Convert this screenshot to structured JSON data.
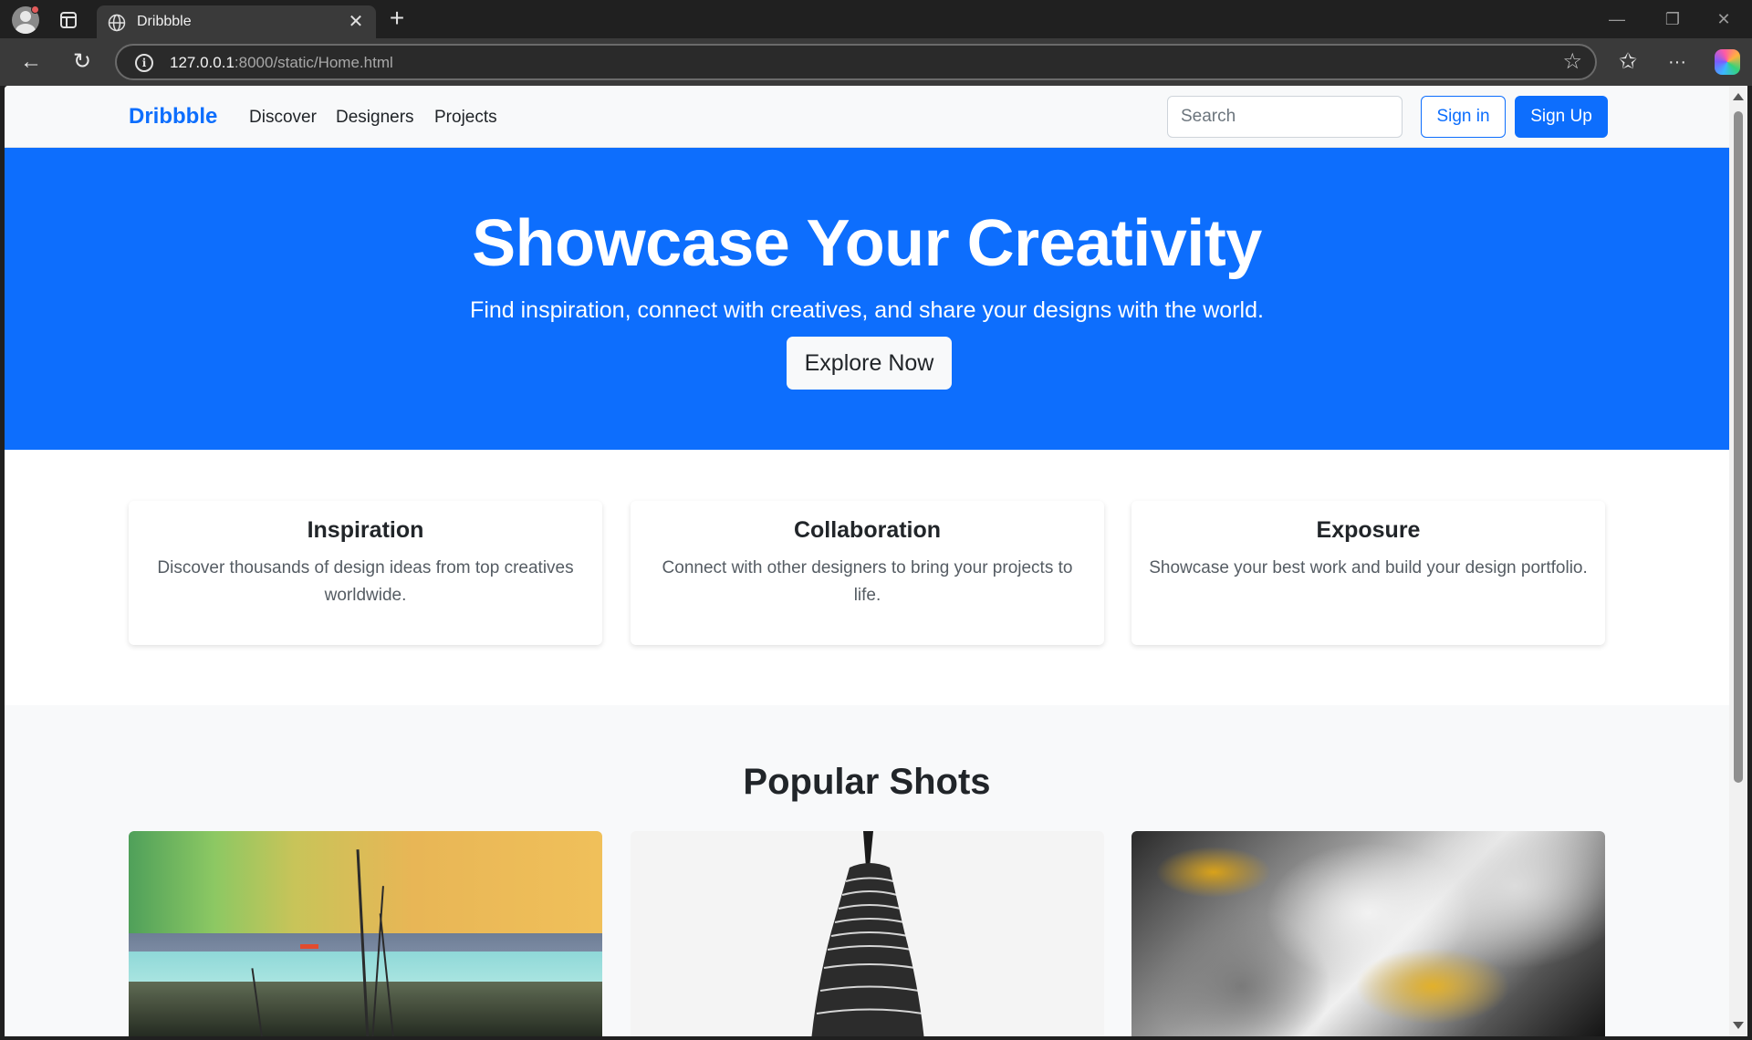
{
  "browser": {
    "tab_title": "Dribbble",
    "url_host": "127.0.0.1",
    "url_rest": ":8000/static/Home.html"
  },
  "navbar": {
    "brand": "Dribbble",
    "links": [
      "Discover",
      "Designers",
      "Projects"
    ],
    "search_placeholder": "Search",
    "signin_label": "Sign in",
    "signup_label": "Sign Up"
  },
  "hero": {
    "title": "Showcase Your Creativity",
    "subtitle": "Find inspiration, connect with creatives, and share your designs with the world.",
    "button_label": "Explore Now"
  },
  "features": [
    {
      "title": "Inspiration",
      "text": "Discover thousands of design ideas from top creatives worldwide."
    },
    {
      "title": "Collaboration",
      "text": "Connect with other designers to bring your projects to life."
    },
    {
      "title": "Exposure",
      "text": "Showcase your best work and build your design portfolio."
    }
  ],
  "popular": {
    "title": "Popular Shots"
  },
  "colors": {
    "primary": "#0d6efd",
    "light_bg": "#f8f9fa",
    "text": "#212529"
  },
  "icons": [
    "profile-icon",
    "tabs-icon",
    "globe-icon",
    "close-icon",
    "plus-icon",
    "back-icon",
    "reload-icon",
    "info-icon",
    "star-icon",
    "favorites-icon",
    "more-icon",
    "copilot-icon"
  ]
}
